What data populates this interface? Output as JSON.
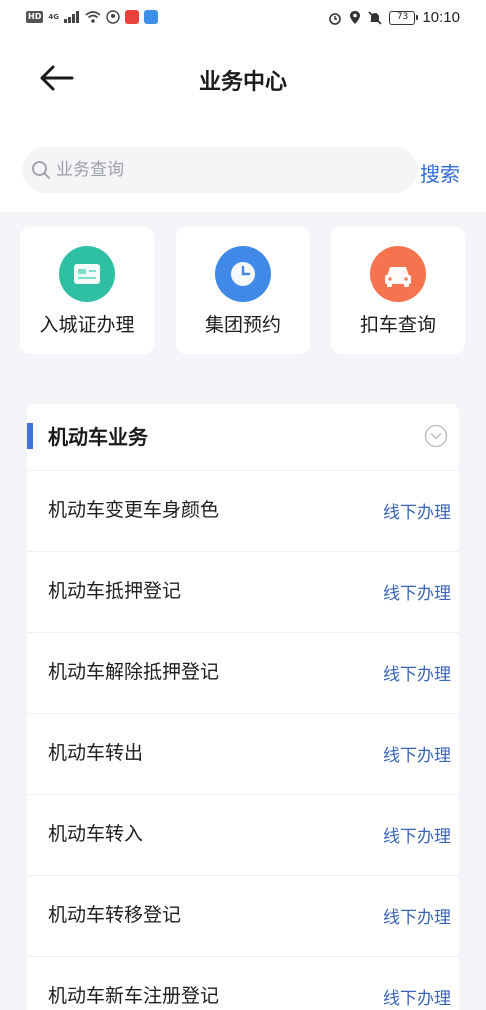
{
  "status_bar": {
    "left_badge": "HD",
    "network": "4G",
    "battery": "73",
    "time": "10:10",
    "app_colors": [
      "#e8423a",
      "#3d8fe8"
    ]
  },
  "nav": {
    "title": "业务中心",
    "back_icon": "arrow-left-icon"
  },
  "search": {
    "placeholder": "业务查询",
    "value": "",
    "button": "搜索"
  },
  "quick_actions": [
    {
      "label": "入城证办理",
      "icon": "card-icon",
      "color": "#2fc0a4"
    },
    {
      "label": "集团预约",
      "icon": "clock-icon",
      "color": "#4189e8"
    },
    {
      "label": "扣车查询",
      "icon": "car-icon",
      "color": "#f5734e"
    }
  ],
  "section": {
    "title": "机动车业务",
    "accent_color": "#3f74dc",
    "items": [
      {
        "label": "机动车变更车身颜色",
        "action": "线下办理"
      },
      {
        "label": "机动车抵押登记",
        "action": "线下办理"
      },
      {
        "label": "机动车解除抵押登记",
        "action": "线下办理"
      },
      {
        "label": "机动车转出",
        "action": "线下办理"
      },
      {
        "label": "机动车转入",
        "action": "线下办理"
      },
      {
        "label": "机动车转移登记",
        "action": "线下办理"
      },
      {
        "label": "机动车新车注册登记",
        "action": "线下办理"
      }
    ]
  }
}
